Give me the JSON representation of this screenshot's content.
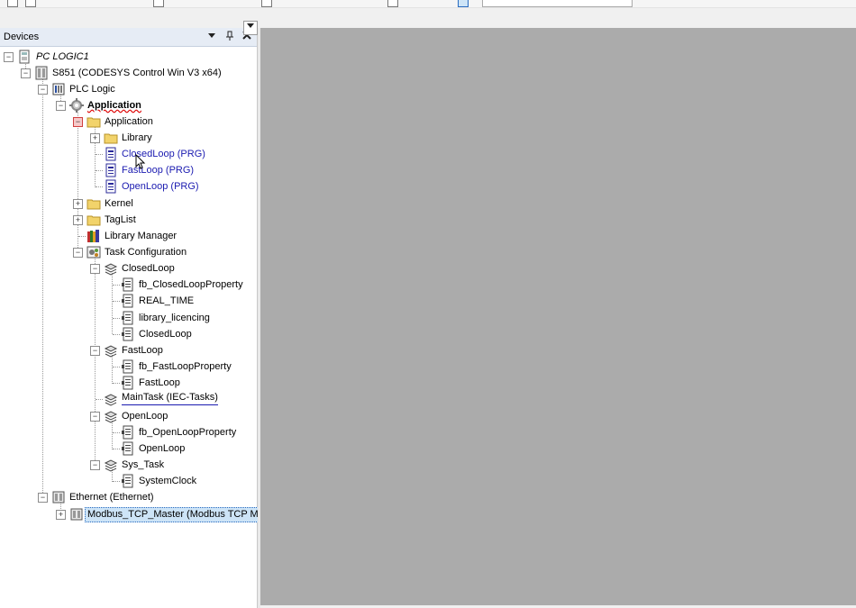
{
  "panel": {
    "title": "Devices",
    "dropdown_glyph": "▾",
    "pin_glyph": "📌",
    "close_glyph": "✕",
    "corner_dropdown_glyph": "▼"
  },
  "tree": {
    "root": "PC LOGIC1",
    "device": "S851 (CODESYS Control Win V3 x64)",
    "plc_logic": "PLC Logic",
    "application": "Application",
    "app_folder": "Application",
    "library_folder": "Library",
    "closed_loop_prg": "ClosedLoop (PRG)",
    "fast_loop_prg": "FastLoop (PRG)",
    "open_loop_prg": "OpenLoop (PRG)",
    "kernel": "Kernel",
    "taglist": "TagList",
    "library_manager": "Library Manager",
    "task_configuration": "Task Configuration",
    "task_closed_loop": "ClosedLoop",
    "fb_closed_loop_property": "fb_ClosedLoopProperty",
    "real_time": "REAL_TIME",
    "library_licencing": "library_licencing",
    "closed_loop_call": "ClosedLoop",
    "task_fast_loop": "FastLoop",
    "fb_fast_loop_property": "fb_FastLoopProperty",
    "fast_loop_call": "FastLoop",
    "main_task": "MainTask (IEC-Tasks)",
    "task_open_loop": "OpenLoop",
    "fb_open_loop_property": "fb_OpenLoopProperty",
    "open_loop_call": "OpenLoop",
    "task_sys": "Sys_Task",
    "system_clock": "SystemClock",
    "ethernet": "Ethernet (Ethernet)",
    "modbus_master": "Modbus_TCP_Master (Modbus TCP Maste"
  },
  "glyphs": {
    "plus": "+",
    "minus": "−"
  },
  "colors": {
    "link_blue": "#1a1ab0",
    "editor_gray": "#ababab",
    "header_bg": "#e6ecf5",
    "selection_bg": "#cde4f7"
  },
  "icons": {
    "device": "device-icon",
    "plc": "plc-logic-icon",
    "application": "gear-icon",
    "folder": "folder-icon",
    "pou": "pou-program-icon",
    "library_manager": "books-icon",
    "task_config": "task-config-icon",
    "task": "task-stack-icon",
    "call": "program-call-icon",
    "ethernet": "ethernet-device-icon"
  }
}
